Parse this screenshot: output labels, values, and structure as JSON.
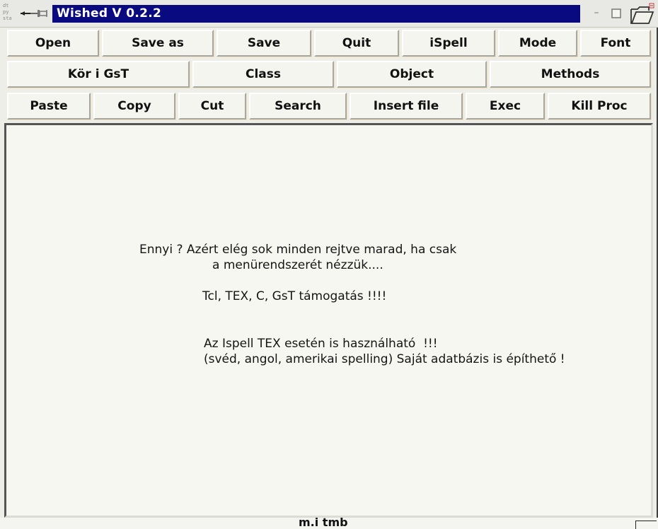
{
  "window": {
    "title": "Wished V 0.2.2",
    "sys_icon_text": "dt\npy\nsta"
  },
  "toolbar_row1": {
    "open": "Open",
    "save_as": "Save as",
    "save": "Save",
    "quit": "Quit",
    "ispell": "iSpell",
    "mode": "Mode",
    "font": "Font"
  },
  "toolbar_row2": {
    "kori_gst": "Kör i GsT",
    "class": "Class",
    "object": "Object",
    "methods": "Methods"
  },
  "toolbar_row3": {
    "paste": "Paste",
    "copy": "Copy",
    "cut": "Cut",
    "search": "Search",
    "insert_file": "Insert file",
    "exec": "Exec",
    "kill_proc": "Kill Proc"
  },
  "editor": {
    "lines": [
      "Ennyi ? Azért elég sok minden rejtve marad, ha csak",
      "a menürendszerét nézzük....",
      "Tcl, TEX, C, GsT támogatás !!!!",
      "Az Ispell TEX esetén is használható  !!!",
      "(svéd, angol, amerikai spelling) Saját adatbázis is építhető !"
    ]
  },
  "status": {
    "text": "m.i  tmb"
  },
  "colors": {
    "title_bg": "#0a0a80",
    "title_fg": "#ffffff",
    "button_bg": "#f5f5ef",
    "editor_bg": "#f7f7f1"
  },
  "icons": {
    "system_menu": "system-menu-icon",
    "pin": "pin-icon",
    "minimize": "minimize-icon",
    "maximize": "maximize-icon",
    "folder": "folder-icon"
  }
}
